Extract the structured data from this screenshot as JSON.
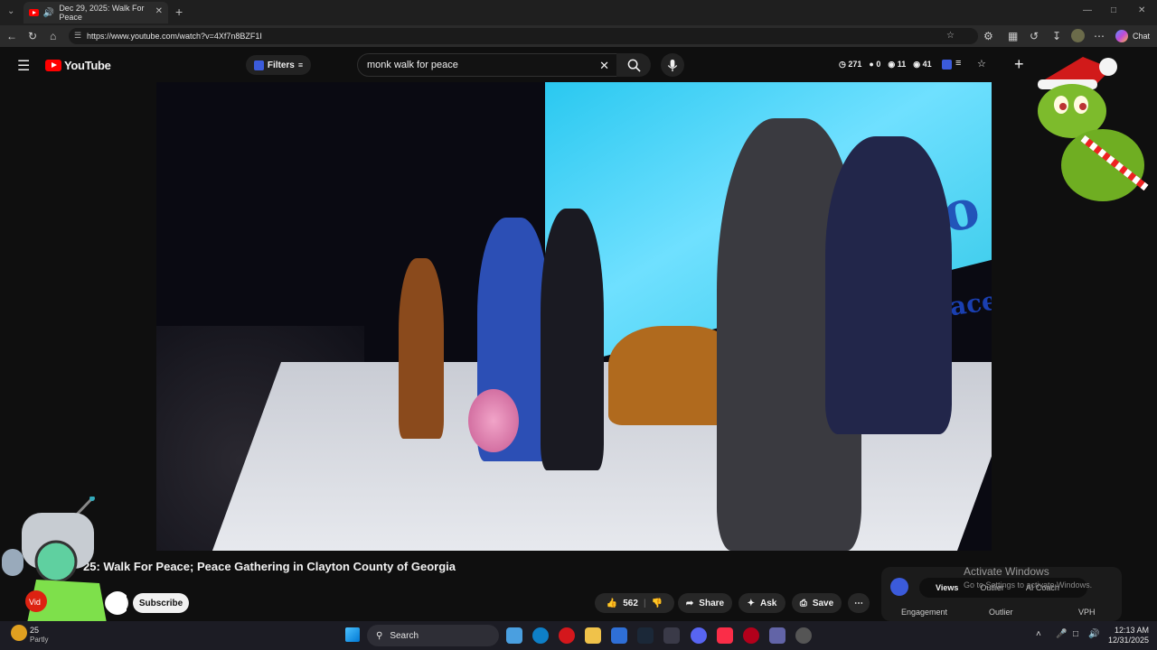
{
  "browser": {
    "tab_title": "Dec 29, 2025: Walk For Peace",
    "url": "https://www.youtube.com/watch?v=4Xf7n8BZF1I",
    "chat_label": "Chat"
  },
  "youtube": {
    "logo_text": "YouTube",
    "filters_label": "Filters",
    "search_value": "monk walk for peace",
    "stats": [
      "271",
      "0",
      "11",
      "41"
    ]
  },
  "video": {
    "title": "25: Walk For Peace; Peace Gathering in Clayton County of Georgia",
    "screen_text": "Walk fo",
    "screen_text2": "eace"
  },
  "actions": {
    "like_count": "562",
    "share_label": "Share",
    "ask_label": "Ask",
    "save_label": "Save",
    "subscribe_label": "Subscribe"
  },
  "analytics": {
    "tabs": [
      "Views",
      "Outlier",
      "AI Coach"
    ],
    "labels": [
      "Engagement",
      "Outlier",
      "VPH"
    ]
  },
  "watermark": {
    "line1": "Activate Windows",
    "line2": "Go to Settings to activate Windows."
  },
  "taskbar": {
    "search_label": "Search",
    "weather_temp": "25",
    "weather_desc": "Partly",
    "time": "12:13 AM",
    "date": "12/31/2025"
  }
}
